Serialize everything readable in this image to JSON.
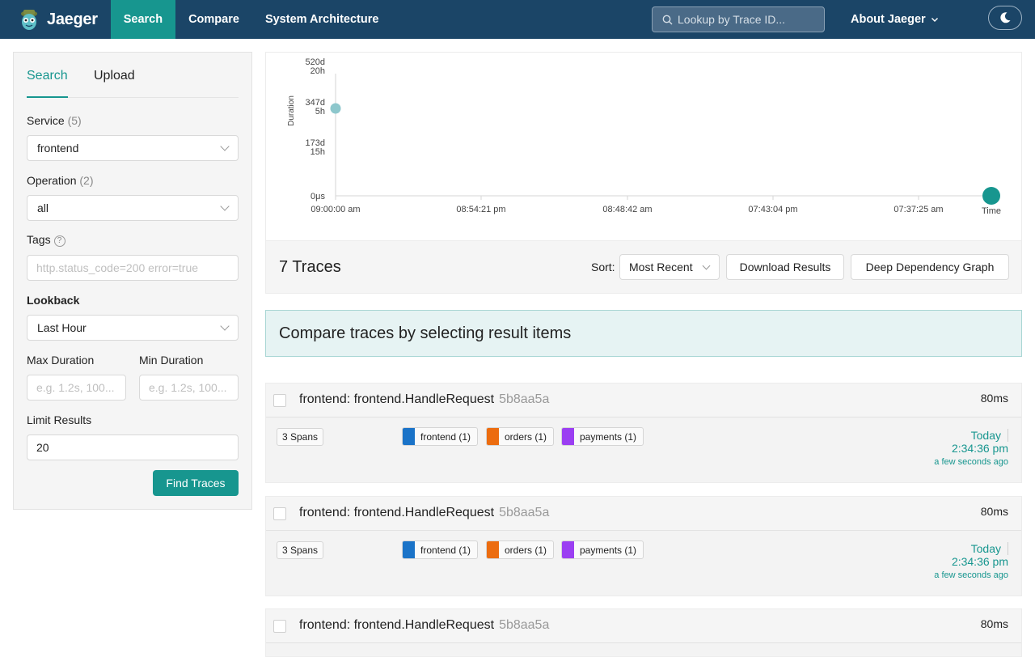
{
  "nav": {
    "brand": "Jaeger",
    "links": [
      "Search",
      "Compare",
      "System Architecture"
    ],
    "lookup_placeholder": "Lookup by Trace ID...",
    "about": "About Jaeger"
  },
  "sidebar": {
    "tabs": [
      "Search",
      "Upload"
    ],
    "service_label": "Service",
    "service_count": "(5)",
    "service_value": "frontend",
    "operation_label": "Operation",
    "operation_count": "(2)",
    "operation_value": "all",
    "tags_label": "Tags",
    "tags_placeholder": "http.status_code=200 error=true",
    "lookback_label": "Lookback",
    "lookback_value": "Last Hour",
    "max_duration_label": "Max Duration",
    "min_duration_label": "Min Duration",
    "max_duration_placeholder": "e.g. 1.2s, 100...",
    "min_duration_placeholder": "e.g. 1.2s, 100...",
    "limit_label": "Limit Results",
    "limit_value": "20",
    "find_button": "Find Traces"
  },
  "chart_data": {
    "type": "scatter",
    "y_ticks": [
      "520d 20h",
      "347d 5h",
      "173d 15h",
      "0μs"
    ],
    "ylabel": "Duration",
    "x_ticks": [
      "09:00:00 am",
      "08:54:21 pm",
      "08:48:42 am",
      "07:43:04 pm",
      "07:37:25 am"
    ],
    "xlabel": "Time",
    "points": [
      {
        "x": "09:00:00 am",
        "y": "347d 5h",
        "color": "#8dc7cc",
        "size": "small"
      },
      {
        "x": "Time",
        "y": "0μs",
        "color": "#17968f",
        "size": "large"
      }
    ]
  },
  "results": {
    "count_label": "7 Traces",
    "sort_label": "Sort:",
    "sort_value": "Most Recent",
    "download_button": "Download Results",
    "ddg_button": "Deep Dependency Graph",
    "compare_banner": "Compare traces by selecting result items"
  },
  "traces": [
    {
      "name": "frontend: frontend.HandleRequest",
      "id": "5b8aa5a",
      "duration": "80ms",
      "spans": "3 Spans",
      "services": [
        {
          "label": "frontend (1)",
          "color": "#1a73c8"
        },
        {
          "label": "orders (1)",
          "color": "#ec6c0f"
        },
        {
          "label": "payments (1)",
          "color": "#9b3ff2"
        }
      ],
      "day": "Today",
      "time": "2:34:36 pm",
      "ago": "a few seconds ago"
    },
    {
      "name": "frontend: frontend.HandleRequest",
      "id": "5b8aa5a",
      "duration": "80ms",
      "spans": "3 Spans",
      "services": [
        {
          "label": "frontend (1)",
          "color": "#1a73c8"
        },
        {
          "label": "orders (1)",
          "color": "#ec6c0f"
        },
        {
          "label": "payments (1)",
          "color": "#9b3ff2"
        }
      ],
      "day": "Today",
      "time": "2:34:36 pm",
      "ago": "a few seconds ago"
    },
    {
      "name": "frontend: frontend.HandleRequest",
      "id": "5b8aa5a",
      "duration": "80ms"
    }
  ]
}
